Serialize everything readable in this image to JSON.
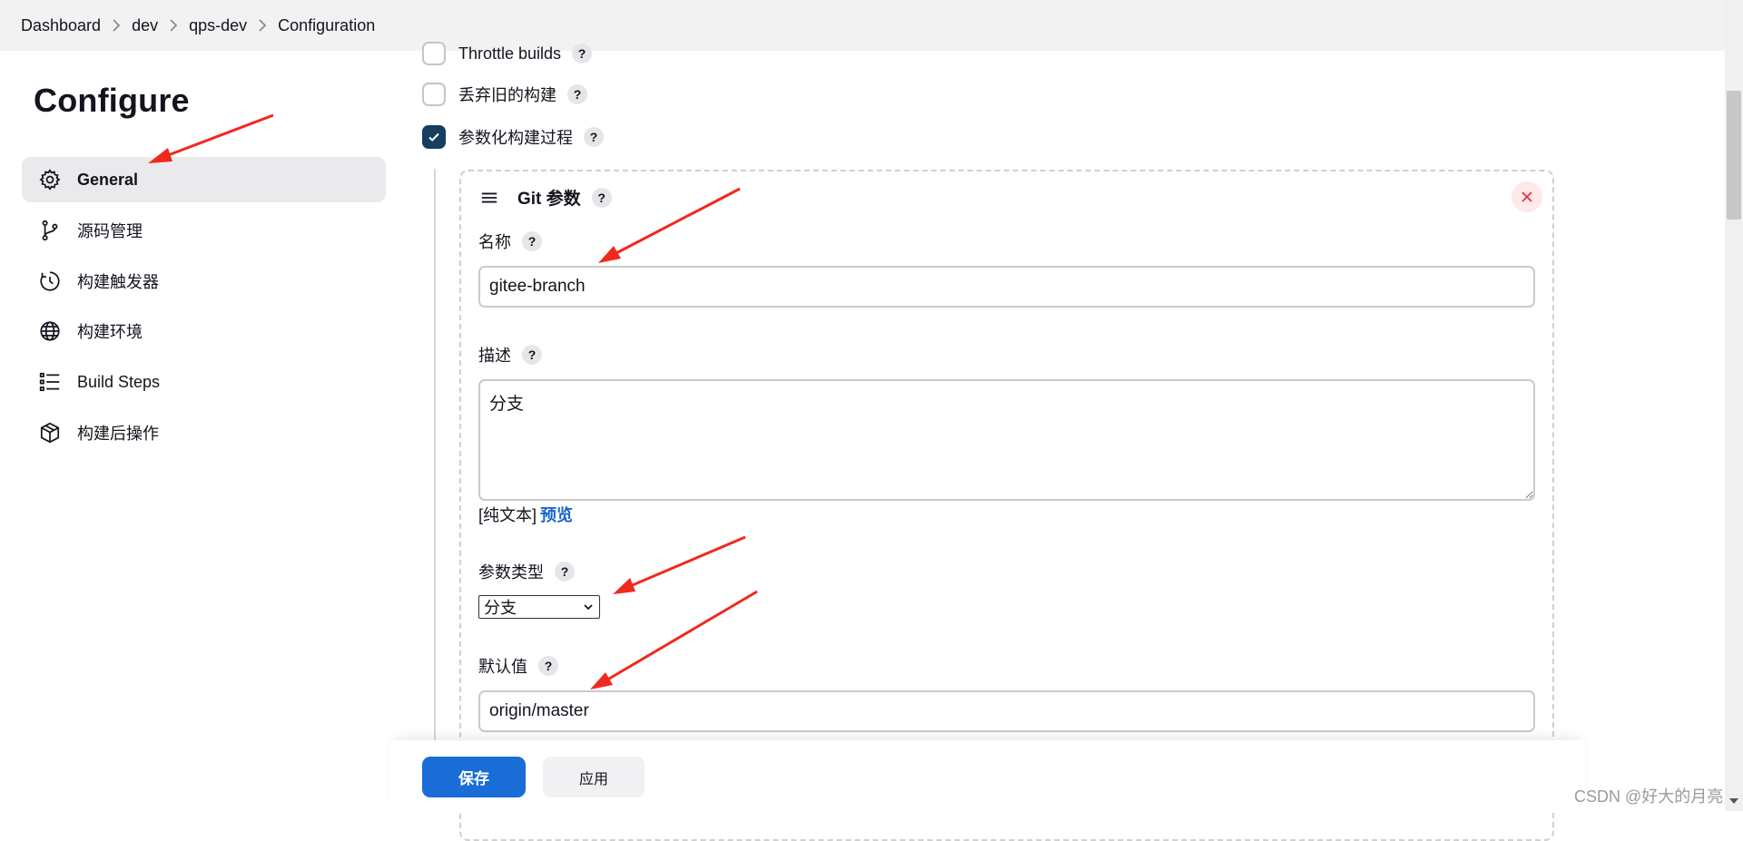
{
  "breadcrumb": {
    "items": [
      "Dashboard",
      "dev",
      "qps-dev",
      "Configuration"
    ]
  },
  "sidebar": {
    "title": "Configure",
    "items": [
      {
        "label": "General",
        "icon": "gear-icon",
        "active": true
      },
      {
        "label": "源码管理",
        "icon": "branch-icon"
      },
      {
        "label": "构建触发器",
        "icon": "clock-icon"
      },
      {
        "label": "构建环境",
        "icon": "globe-icon"
      },
      {
        "label": "Build Steps",
        "icon": "list-icon"
      },
      {
        "label": "构建后操作",
        "icon": "package-icon"
      }
    ]
  },
  "options": {
    "throttle": {
      "label": "Throttle builds",
      "checked": false
    },
    "discard": {
      "label": "丢弃旧的构建",
      "checked": false
    },
    "parameterized": {
      "label": "参数化构建过程",
      "checked": true
    }
  },
  "param": {
    "title": "Git 参数",
    "name_label": "名称",
    "name_value": "gitee-branch",
    "desc_label": "描述",
    "desc_value": "分支",
    "plain_text": "[纯文本]",
    "preview": "预览",
    "type_label": "参数类型",
    "type_value": "分支",
    "default_label": "默认值",
    "default_value": "origin/master"
  },
  "help_glyph": "?",
  "actions": {
    "save": "保存",
    "apply": "应用"
  },
  "watermark": "CSDN @好大的月亮",
  "colors": {
    "annotation_arrow": "#f0291e",
    "primary_button": "#1a6cd6",
    "checkbox_checked": "#163e60",
    "link": "#1866c9"
  }
}
